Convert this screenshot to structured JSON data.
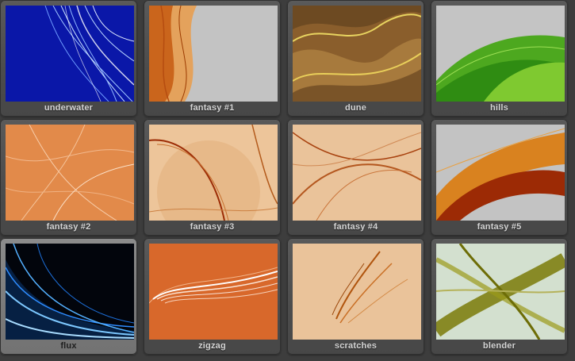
{
  "tiles": [
    {
      "label": "underwater",
      "selected": false
    },
    {
      "label": "fantasy #1",
      "selected": false
    },
    {
      "label": "dune",
      "selected": false
    },
    {
      "label": "hills",
      "selected": false
    },
    {
      "label": "fantasy #2",
      "selected": false
    },
    {
      "label": "fantasy #3",
      "selected": false
    },
    {
      "label": "fantasy #4",
      "selected": false
    },
    {
      "label": "fantasy #5",
      "selected": false
    },
    {
      "label": "flux",
      "selected": true
    },
    {
      "label": "zigzag",
      "selected": false
    },
    {
      "label": "scratches",
      "selected": false
    },
    {
      "label": "blender",
      "selected": false
    }
  ]
}
